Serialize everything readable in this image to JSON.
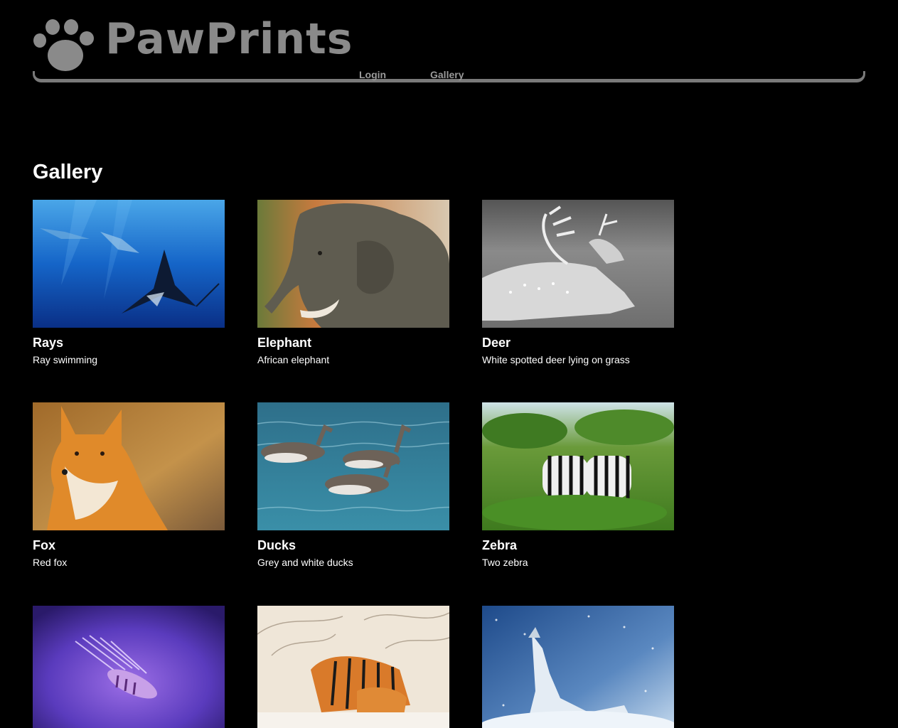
{
  "site": {
    "brand": "PawPrints",
    "logo_icon": "paw-icon"
  },
  "nav": {
    "login_label": "Login",
    "gallery_label": "Gallery"
  },
  "main": {
    "title": "Gallery"
  },
  "gallery": [
    {
      "title": "Rays",
      "description": "Ray swimming"
    },
    {
      "title": "Elephant",
      "description": "African elephant"
    },
    {
      "title": "Deer",
      "description": "White spotted deer lying on grass"
    },
    {
      "title": "Fox",
      "description": "Red fox"
    },
    {
      "title": "Ducks",
      "description": "Grey and white ducks"
    },
    {
      "title": "Zebra",
      "description": "Two zebra"
    },
    {
      "title": "",
      "description": ""
    },
    {
      "title": "",
      "description": ""
    },
    {
      "title": "",
      "description": ""
    }
  ],
  "colors": {
    "background": "#000000",
    "brand_grey": "#8a8a8a",
    "nav_grey": "#9a9a9a",
    "text": "#ffffff"
  }
}
